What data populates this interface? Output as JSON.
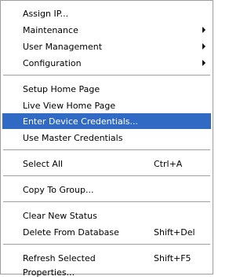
{
  "menu": {
    "items": [
      {
        "label": "Assign IP..."
      },
      {
        "label": "Maintenance",
        "submenu": true
      },
      {
        "label": "User Management",
        "submenu": true
      },
      {
        "label": "Configuration",
        "submenu": true
      },
      {
        "label": "Setup Home Page"
      },
      {
        "label": "Live View Home Page"
      },
      {
        "label": "Enter Device Credentials...",
        "selected": true
      },
      {
        "label": "Use Master Credentials"
      },
      {
        "label": "Select All",
        "shortcut": "Ctrl+A"
      },
      {
        "label": "Copy To Group..."
      },
      {
        "label": "Clear New Status"
      },
      {
        "label": "Delete From Database",
        "shortcut": "Shift+Del"
      },
      {
        "label": "Refresh Selected",
        "shortcut": "Shift+F5"
      },
      {
        "label": "Properties..."
      }
    ]
  },
  "colors": {
    "selection": "#316ac5",
    "separator": "#a0a0a0",
    "border": "#9d9d9d"
  }
}
